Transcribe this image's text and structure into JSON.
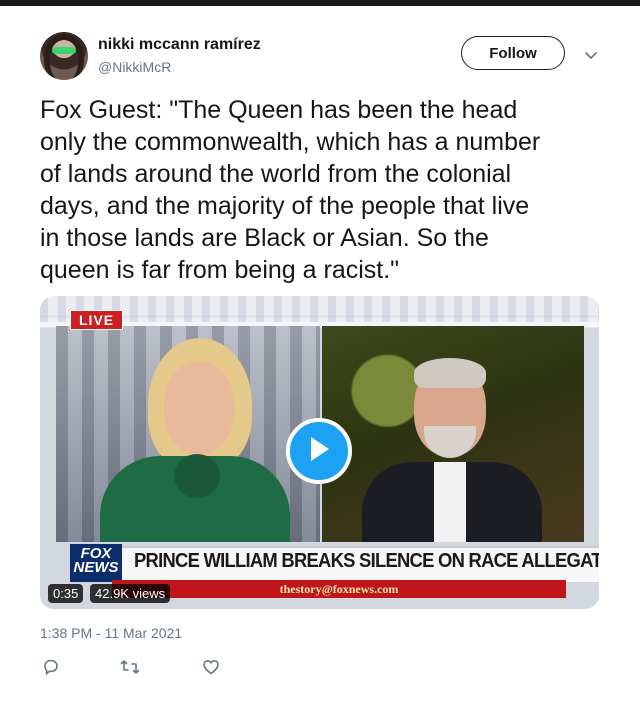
{
  "tweet": {
    "author_name": "nikki mccann ramírez",
    "author_handle": "@NikkiMcR",
    "follow_label": "Follow",
    "text": "Fox Guest: \"The Queen has been the head\nonly the commonwealth, which has a number\nof lands around the world from the colonial\ndays, and the majority of the people that live\nin those lands are Black or Asian. So the\nqueen is far from being a racist.\"",
    "timestamp": "1:38 PM - 11 Mar 2021"
  },
  "video": {
    "live_badge": "LIVE",
    "network_logo": "FOX NEWS",
    "headline": "PRINCE WILLIAM BREAKS SILENCE ON RACE ALLEGATIONS",
    "contact": "thestory@foxnews.com",
    "duration": "0:35",
    "views": "42.9K views"
  },
  "icons": {
    "caret": "chevron-down-icon",
    "play": "play-icon",
    "reply": "reply-icon",
    "retweet": "retweet-icon",
    "like": "heart-icon"
  },
  "colors": {
    "accent": "#1da1f2",
    "secondary_text": "#657786",
    "text": "#14171a",
    "fox_red": "#c0151b",
    "fox_blue": "#0b2d6b",
    "live_red": "#cc1f24"
  }
}
